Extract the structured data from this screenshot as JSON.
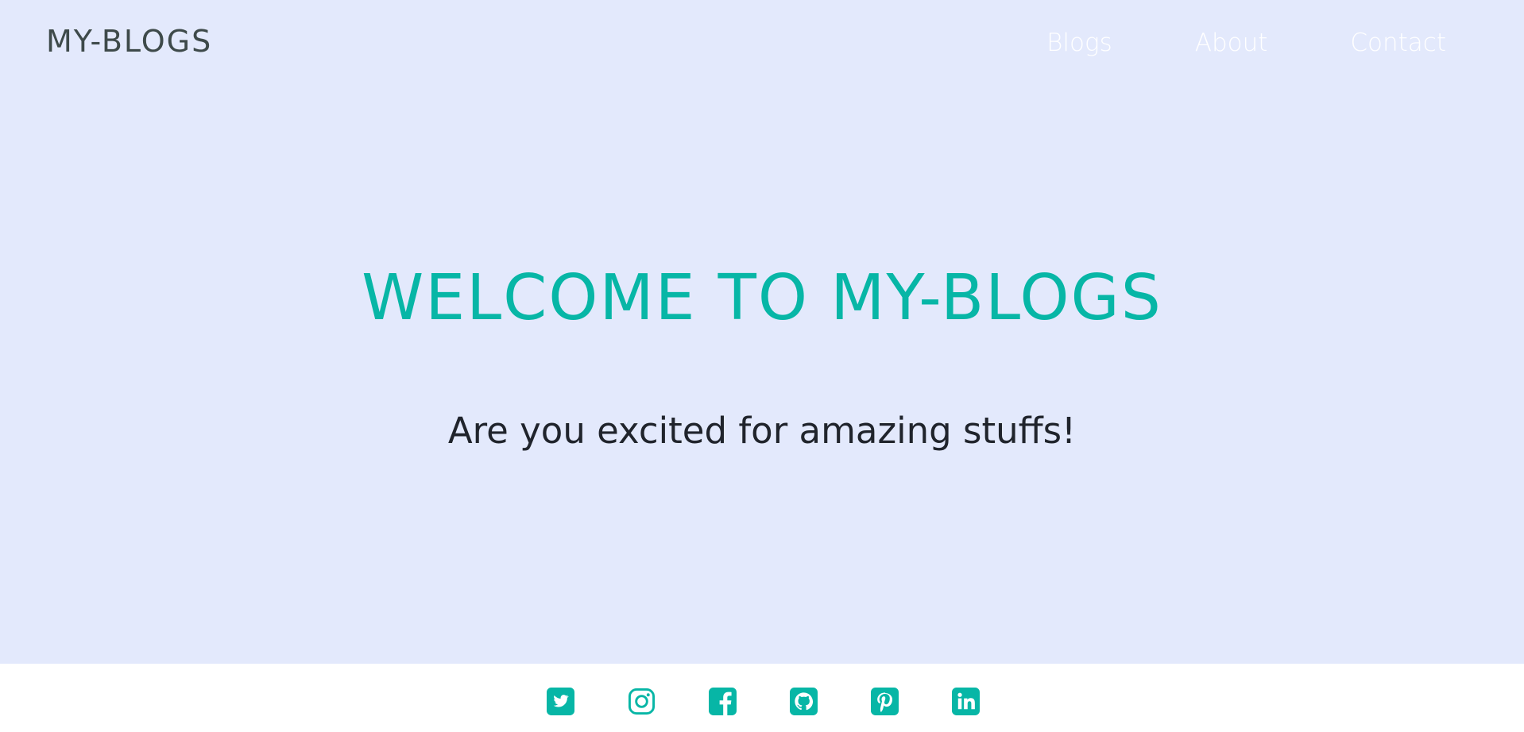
{
  "header": {
    "brand": "MY-BLOGS",
    "nav": {
      "blogs": "Blogs",
      "about": "About",
      "contact": "Contact"
    }
  },
  "hero": {
    "title": "WELCOME TO MY-BLOGS",
    "subtitle": "Are you excited for amazing stuffs!"
  },
  "footer": {
    "social_icons": [
      "twitter-icon",
      "instagram-icon",
      "facebook-icon",
      "github-icon",
      "pinterest-icon",
      "linkedin-icon"
    ]
  },
  "colors": {
    "hero_background": "#e3e9fc",
    "accent": "#07b6a6",
    "brand_text": "#3e4a4a",
    "nav_text": "#ffffff",
    "subtitle_text": "#20242c"
  }
}
